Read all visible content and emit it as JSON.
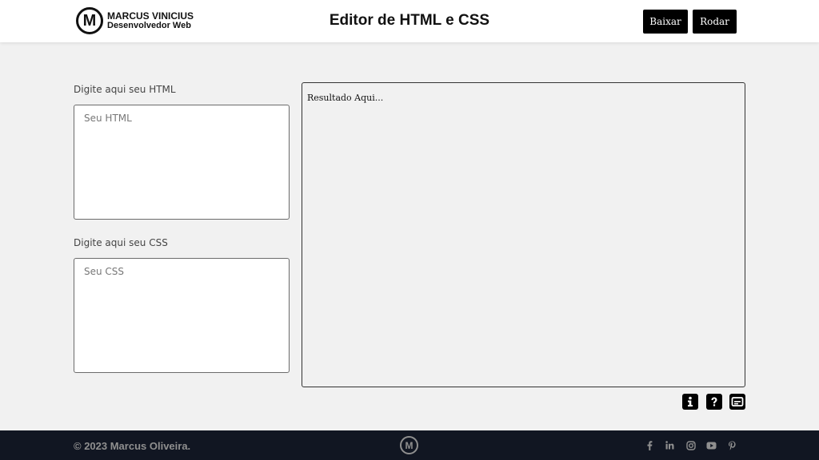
{
  "header": {
    "logo_letter": "M",
    "logo_name": "MARCUS VINICIUS",
    "logo_role": "Desenvolvedor Web",
    "title": "Editor de HTML e CSS",
    "download_label": "Baixar",
    "run_label": "Rodar"
  },
  "editor": {
    "html_label": "Digite aqui seu HTML",
    "html_placeholder": "Seu HTML",
    "html_value": "",
    "css_label": "Digite aqui seu CSS",
    "css_placeholder": "Seu CSS",
    "css_value": "",
    "result_text": "Resultado Aqui..."
  },
  "actions": {
    "icons": [
      "info-icon",
      "help-icon",
      "subtitles-icon"
    ]
  },
  "footer": {
    "copyright": "© 2023 Marcus Oliveira.",
    "logo_letter": "M",
    "social_icons": [
      "facebook-icon",
      "linkedin-icon",
      "instagram-icon",
      "youtube-icon",
      "pinterest-icon"
    ]
  },
  "colors": {
    "header_bg": "#ffffff",
    "page_bg": "#f1f1f1",
    "button_bg": "#000000",
    "footer_bg": "#111622",
    "footer_text": "#8f8f8f"
  }
}
